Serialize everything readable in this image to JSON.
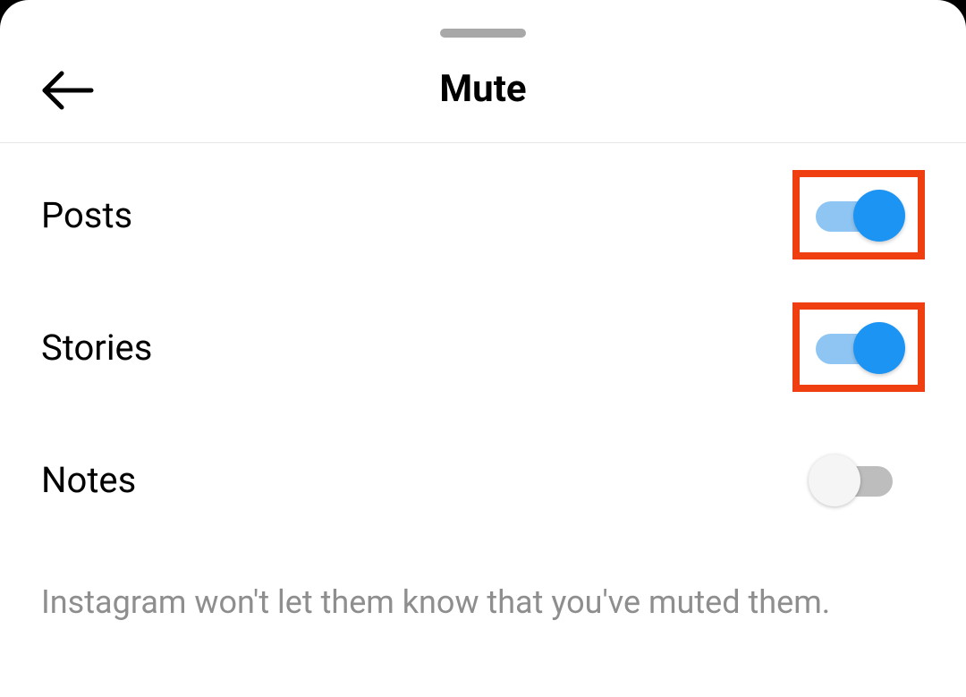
{
  "header": {
    "title": "Mute"
  },
  "settings": [
    {
      "label": "Posts",
      "enabled": true,
      "highlighted": true
    },
    {
      "label": "Stories",
      "enabled": true,
      "highlighted": true
    },
    {
      "label": "Notes",
      "enabled": false,
      "highlighted": false
    }
  ],
  "footer": {
    "note": "Instagram won't let them know that you've muted them."
  },
  "colors": {
    "highlight": "#ef3e0f",
    "toggle_on": "#1c94f4",
    "toggle_on_track": "#8fc5f3",
    "toggle_off_track": "#bdbdbd"
  }
}
